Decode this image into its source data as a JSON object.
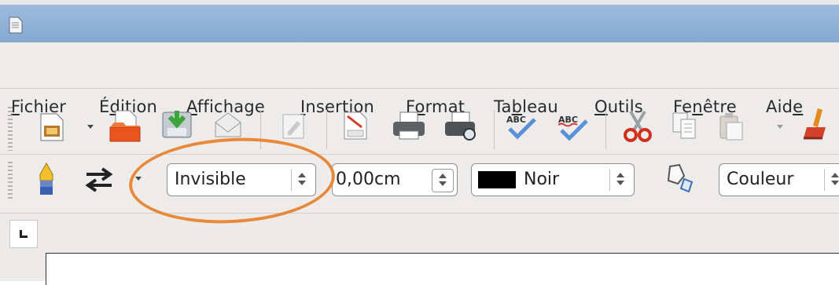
{
  "menubar": {
    "items": [
      {
        "pre": "",
        "mn": "F",
        "post": "ichier"
      },
      {
        "pre": "É",
        "mn": "d",
        "post": "ition"
      },
      {
        "pre": "",
        "mn": "A",
        "post": "ffichage"
      },
      {
        "pre": "",
        "mn": "I",
        "post": "nsertion"
      },
      {
        "pre": "F",
        "mn": "o",
        "post": "rmat"
      },
      {
        "pre": "Ta",
        "mn": "b",
        "post": "leau"
      },
      {
        "pre": "",
        "mn": "O",
        "post": "utils"
      },
      {
        "pre": "Fe",
        "mn": "n",
        "post": "être"
      },
      {
        "pre": "Aid",
        "mn": "e",
        "post": ""
      }
    ]
  },
  "toolbar": {
    "icons": [
      "new-document-icon",
      "open-icon",
      "save-icon",
      "email-document-icon",
      "edit-file-icon",
      "export-pdf-icon",
      "print-icon",
      "print-preview-icon",
      "spellcheck-icon",
      "autospellcheck-icon",
      "cut-icon",
      "copy-icon",
      "paste-icon",
      "format-paintbrush-icon"
    ]
  },
  "drawing_toolbar": {
    "line_style": "Invisible",
    "line_width": "0,00cm",
    "line_color_name": "Noir",
    "line_color": "#000000",
    "area_style": "Couleur"
  },
  "highlight_color": "#e8893a"
}
